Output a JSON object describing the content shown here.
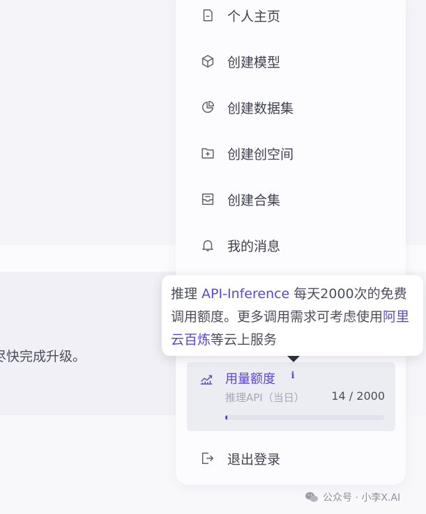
{
  "background": {
    "snippet_text": "尽快完成升级。"
  },
  "menu": {
    "items": [
      {
        "label": "个人主页",
        "icon": "profile-icon"
      },
      {
        "label": "创建模型",
        "icon": "cube-icon"
      },
      {
        "label": "创建数据集",
        "icon": "pie-chart-icon"
      },
      {
        "label": "创建创空间",
        "icon": "folder-plus-icon"
      },
      {
        "label": "创建合集",
        "icon": "collection-icon"
      },
      {
        "label": "我的消息",
        "icon": "bell-icon"
      }
    ],
    "logout_label": "退出登录"
  },
  "usage": {
    "title": "用量额度",
    "info": "i",
    "subtitle": "推理API（当日）",
    "used": 14,
    "limit": 2000,
    "count_text": "14 / 2000",
    "accent_color": "#5a46d6"
  },
  "tooltip": {
    "part1": "推理 ",
    "highlight1": "API-Inference",
    "part2": " 每天2000次的免费调用额度。更多调用需求可考虑使用",
    "highlight2": "阿里云百炼",
    "part3": "等云上服务"
  },
  "watermark": {
    "text": "公众号 · 小李X.AI"
  }
}
